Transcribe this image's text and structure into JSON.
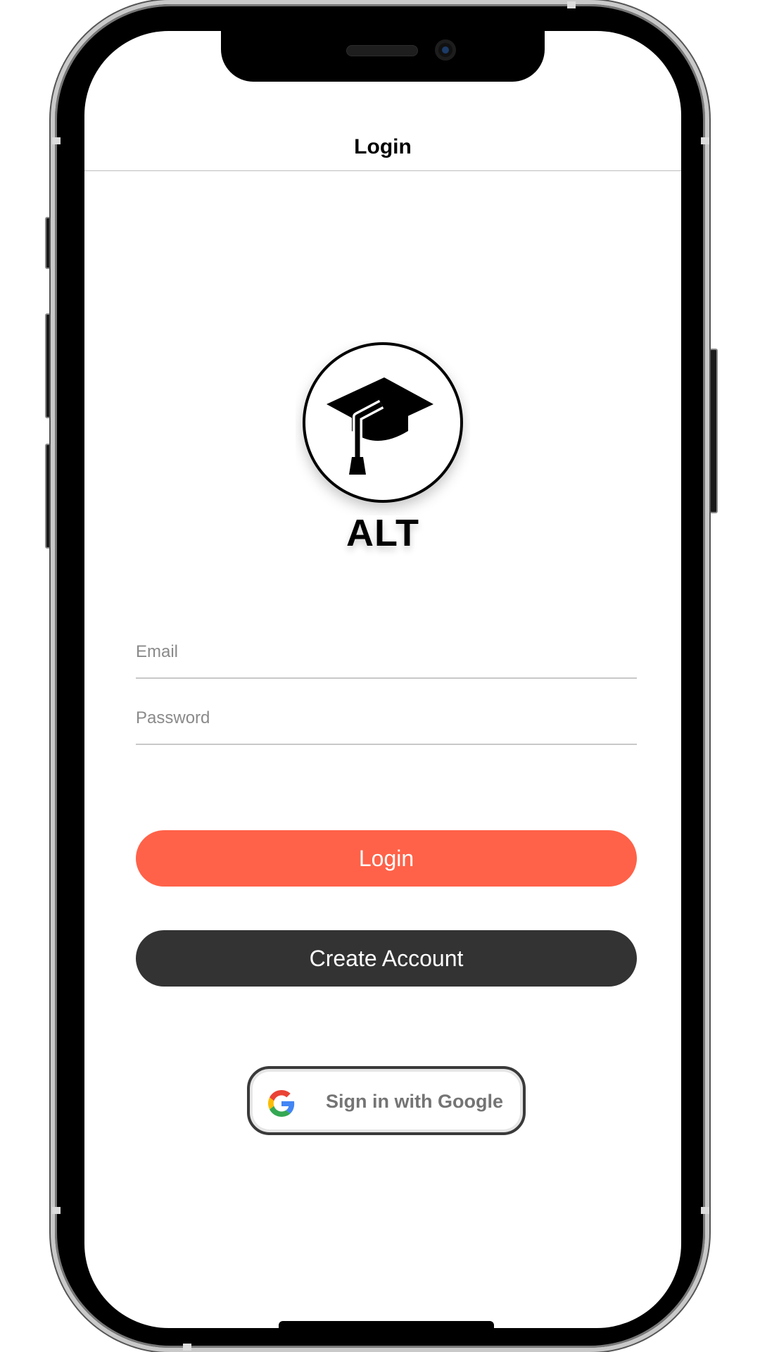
{
  "nav": {
    "title": "Login"
  },
  "logo": {
    "text": "ALT",
    "icon": "graduation-cap-icon"
  },
  "form": {
    "email_placeholder": "Email",
    "email_value": "",
    "password_placeholder": "Password",
    "password_value": ""
  },
  "buttons": {
    "login_label": "Login",
    "create_account_label": "Create Account",
    "google_label": "Sign in with Google"
  },
  "colors": {
    "login_button": "#FF6249",
    "create_account_button": "#333333",
    "google_text": "#747474"
  }
}
